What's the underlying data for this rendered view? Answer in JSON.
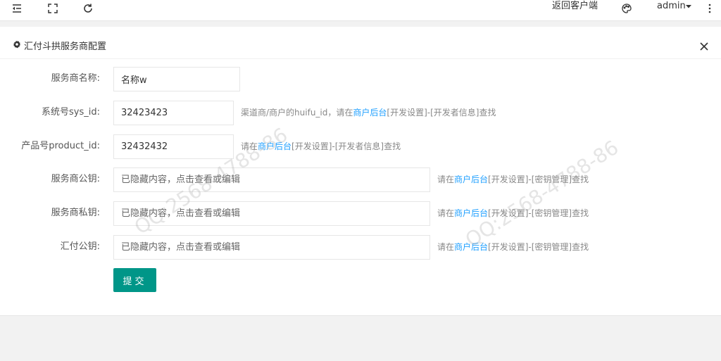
{
  "topbar": {
    "back_to_client": "返回客户端",
    "user": "admin"
  },
  "panel": {
    "title": "汇付斗拱服务商配置"
  },
  "form": {
    "name": {
      "label": "服务商名称:",
      "value": "名称w"
    },
    "sys_id": {
      "label": "系统号sys_id:",
      "value": "32423423",
      "hint_prefix": "渠道商/商户的huifu_id，请在",
      "hint_link": "商户后台",
      "hint_suffix": "[开发设置]-[开发者信息]查找"
    },
    "product_id": {
      "label": "产品号product_id:",
      "value": "32432432",
      "hint_prefix": "请在",
      "hint_link": "商户后台",
      "hint_suffix": "[开发设置]-[开发者信息]查找"
    },
    "public_key": {
      "label": "服务商公钥:",
      "placeholder": "已隐藏内容，点击查看或编辑",
      "hint_prefix": "请在",
      "hint_link": "商户后台",
      "hint_suffix": "[开发设置]-[密钥管理]查找"
    },
    "private_key": {
      "label": "服务商私钥:",
      "placeholder": "已隐藏内容，点击查看或编辑",
      "hint_prefix": "请在",
      "hint_link": "商户后台",
      "hint_suffix": "[开发设置]-[密钥管理]查找"
    },
    "huifu_public_key": {
      "label": "汇付公钥:",
      "placeholder": "已隐藏内容，点击查看或编辑",
      "hint_prefix": "请在",
      "hint_link": "商户后台",
      "hint_suffix": "[开发设置]-[密钥管理]查找"
    },
    "submit_label": "提交"
  },
  "watermark": {
    "text": "QQ:2568-4788-86"
  },
  "icons": {
    "menu": "menu-fold-icon",
    "fullscreen": "fullscreen-icon",
    "refresh": "refresh-icon",
    "theme": "palette-icon",
    "dropdown": "caret-down-icon",
    "more": "more-vertical-icon",
    "title": "gear-icon",
    "close": "close-icon"
  }
}
